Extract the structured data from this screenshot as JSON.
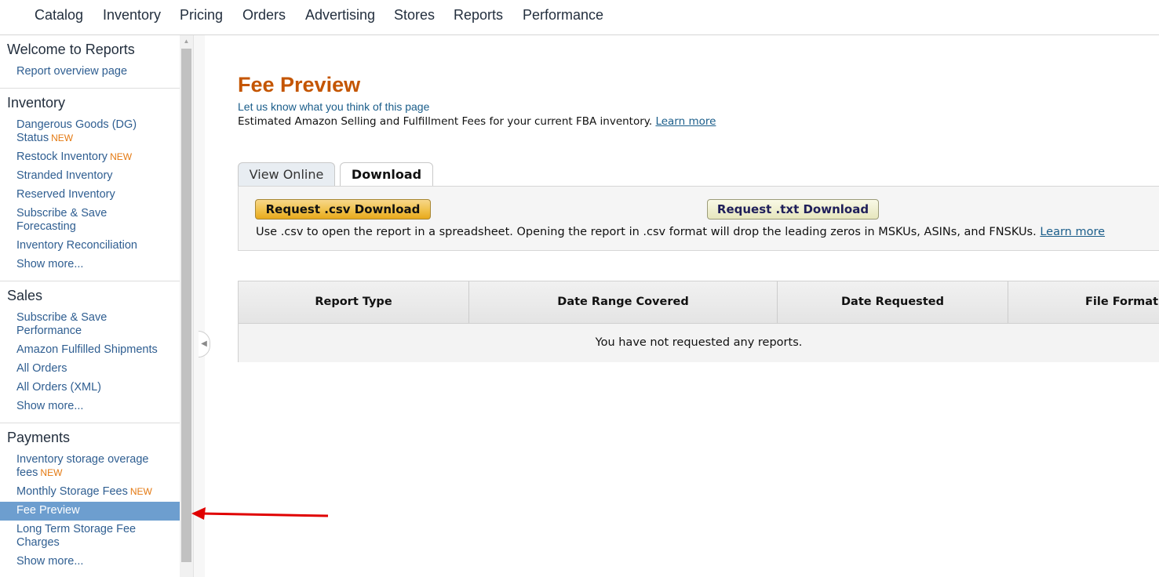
{
  "topnav": {
    "items": [
      "Catalog",
      "Inventory",
      "Pricing",
      "Orders",
      "Advertising",
      "Stores",
      "Reports",
      "Performance"
    ]
  },
  "sidebar": {
    "sections": [
      {
        "title": "Welcome to Reports",
        "links": [
          {
            "label": "Report overview page"
          }
        ]
      },
      {
        "title": "Inventory",
        "links": [
          {
            "label": "Dangerous Goods (DG) Status",
            "badge": "NEW"
          },
          {
            "label": "Restock Inventory",
            "badge": "NEW"
          },
          {
            "label": "Stranded Inventory"
          },
          {
            "label": "Reserved Inventory"
          },
          {
            "label": "Subscribe & Save Forecasting"
          },
          {
            "label": "Inventory Reconciliation"
          },
          {
            "label": "Show more..."
          }
        ]
      },
      {
        "title": "Sales",
        "links": [
          {
            "label": "Subscribe & Save Performance"
          },
          {
            "label": "Amazon Fulfilled Shipments"
          },
          {
            "label": "All Orders"
          },
          {
            "label": "All Orders (XML)"
          },
          {
            "label": "Show more..."
          }
        ]
      },
      {
        "title": "Payments",
        "links": [
          {
            "label": "Inventory storage overage fees",
            "badge": "NEW"
          },
          {
            "label": "Monthly Storage Fees",
            "badge": "NEW"
          },
          {
            "label": "Fee Preview",
            "active": true
          },
          {
            "label": "Long Term Storage Fee Charges"
          },
          {
            "label": "Show more..."
          }
        ]
      }
    ]
  },
  "main": {
    "title": "Fee Preview",
    "feedback_link": "Let us know what you think of this page",
    "description": "Estimated Amazon Selling and Fulfillment Fees for your current FBA inventory.",
    "description_link": "Learn more",
    "tabs": [
      {
        "label": "View Online",
        "active": false
      },
      {
        "label": "Download",
        "active": true
      }
    ],
    "download": {
      "csv_button": "Request .csv Download",
      "txt_button": "Request .txt Download",
      "note": "Use .csv to open the report in a spreadsheet. Opening the report in .csv format will drop the leading zeros in MSKUs, ASINs, and FNSKUs.",
      "note_link": "Learn more"
    },
    "table": {
      "columns": [
        "Report Type",
        "Date Range Covered",
        "Date Requested",
        "File Format"
      ],
      "empty_message": "You have not requested any reports."
    }
  },
  "colors": {
    "title": "#c45500",
    "link": "#2f5e91",
    "new_badge": "#e47911",
    "active_item_bg": "#6d9ecf",
    "annotation_arrow": "#e00000"
  }
}
